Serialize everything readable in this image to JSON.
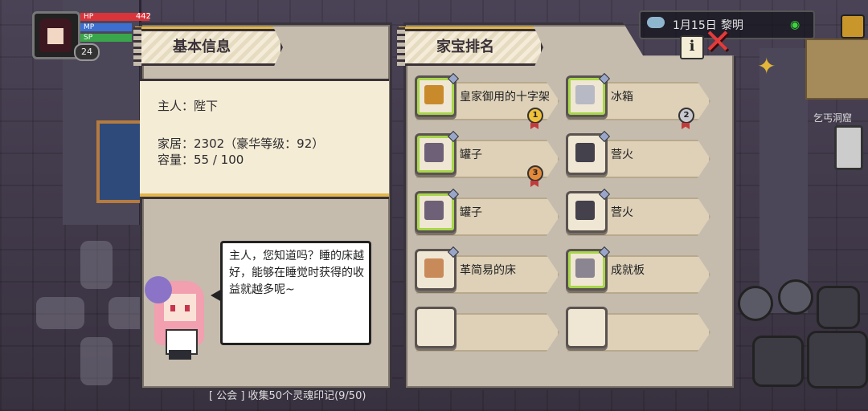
{
  "hud": {
    "level": "24",
    "hp_label": "HP",
    "hp_value": "442",
    "mp_label": "MP",
    "sp_label": "SP",
    "date": "1月15日",
    "period": "黎明",
    "map_name": "乞丐洞窟",
    "weather_icon": "cloud-rain-icon",
    "colors": {
      "hp": "#d8343a",
      "mp": "#3d6fd1",
      "sp": "#3aa54a"
    }
  },
  "left_panel": {
    "title": "基本信息",
    "owner": "主人：陛下",
    "home": "家居：2302（豪华等级：92）",
    "capacity": "容量：55 / 100",
    "maid_speech": "主人，您知道吗？睡的床越好，能够在睡觉时获得的收益就越多呢~"
  },
  "right_panel": {
    "title": "家宝排名",
    "items": [
      {
        "name": "皇家御用的十字架",
        "medal": "1",
        "active": true,
        "icon": "cross-icon"
      },
      {
        "name": "冰箱",
        "medal": "2",
        "active": true,
        "icon": "fridge-icon"
      },
      {
        "name": "罐子",
        "medal": "3",
        "active": true,
        "icon": "jar-icon"
      },
      {
        "name": "营火",
        "medal": "",
        "active": false,
        "icon": "campfire-icon"
      },
      {
        "name": "罐子",
        "medal": "",
        "active": true,
        "icon": "jar-icon"
      },
      {
        "name": "营火",
        "medal": "",
        "active": false,
        "icon": "campfire-icon"
      },
      {
        "name": "革简易的床",
        "medal": "",
        "active": false,
        "icon": "bed-icon"
      },
      {
        "name": "成就板",
        "medal": "",
        "active": true,
        "icon": "board-icon"
      },
      {
        "name": "",
        "medal": "",
        "active": false,
        "icon": ""
      },
      {
        "name": "",
        "medal": "",
        "active": false,
        "icon": ""
      }
    ]
  },
  "chat": {
    "line": "[ 公会 ] 收集50个灵魂印记(9/50)"
  }
}
